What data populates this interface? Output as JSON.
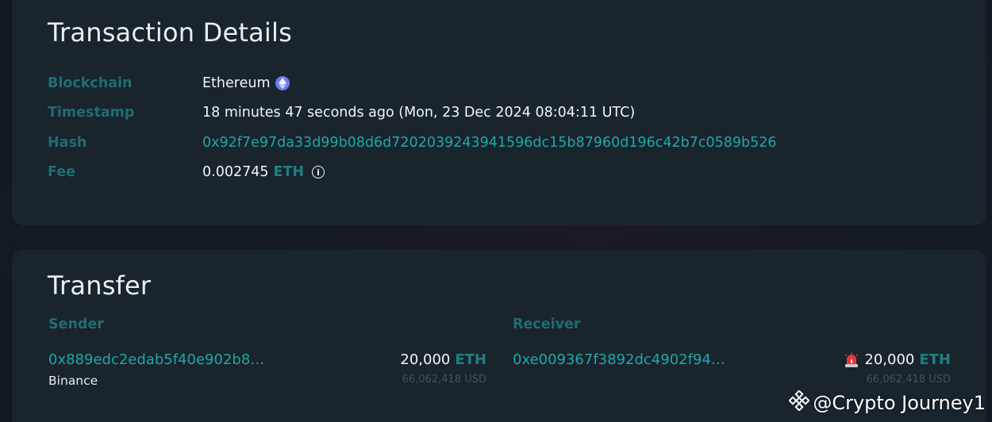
{
  "details": {
    "title": "Transaction Details",
    "rows": [
      {
        "label": "Blockchain",
        "value": "Ethereum",
        "icon": "ethereum-icon"
      },
      {
        "label": "Timestamp",
        "value": "18 minutes 47 seconds ago (Mon, 23 Dec 2024 08:04:11 UTC)"
      },
      {
        "label": "Hash",
        "value": "0x92f7e97da33d99b08d6d7202039243941596dc15b87960d196c42b7c0589b526"
      },
      {
        "label": "Fee",
        "value": "0.002745",
        "unit": "ETH",
        "icon": "info-icon"
      }
    ]
  },
  "transfer": {
    "title": "Transfer",
    "sender": {
      "heading": "Sender",
      "address": "0x889edc2edab5f40e902b8…",
      "entity": "Binance",
      "amount": "20,000",
      "unit": "ETH",
      "usd": "66,062,418 USD"
    },
    "receiver": {
      "heading": "Receiver",
      "address": "0xe009367f3892dc4902f94…",
      "amount": "20,000",
      "unit": "ETH",
      "usd": "66,062,418 USD",
      "icon": "alert-siren-icon"
    }
  },
  "watermark": {
    "text": "@Crypto Journey1",
    "icon": "binance-logo-icon"
  },
  "colors": {
    "label": "#1f6d73",
    "link": "#1fa8a8",
    "card": "#19242c",
    "eth_icon": "#6b7cf0",
    "alert": "#e23b3b"
  }
}
